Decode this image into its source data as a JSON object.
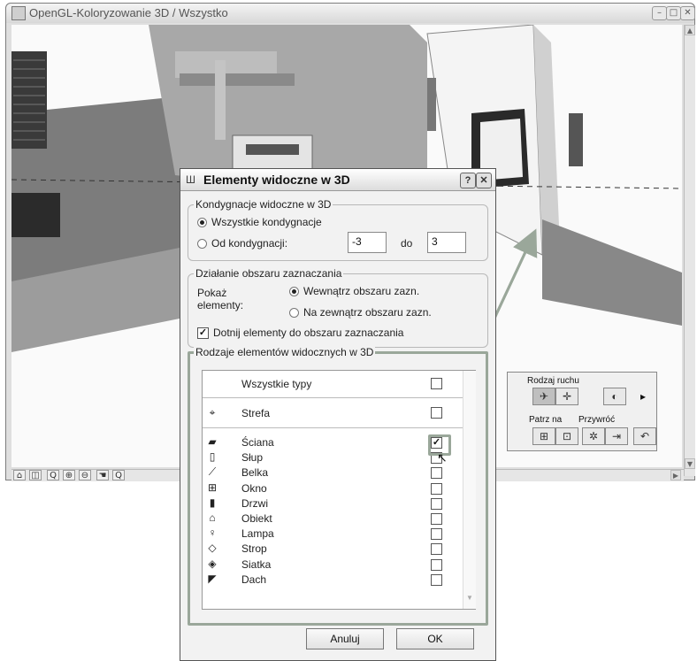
{
  "main_window": {
    "title": "OpenGL-Koloryzowanie 3D / Wszystko",
    "controls": [
      "–",
      "□",
      "✕"
    ],
    "nav_toolbar": [
      "⌂",
      "◫",
      "Q",
      "⊕",
      "⊖",
      "☚",
      "Q"
    ]
  },
  "nav_palette": {
    "movement_label": "Rodzaj ruchu",
    "look_at_label": "Patrz na",
    "restore_label": "Przywróć",
    "expand": "▸"
  },
  "dialog": {
    "title": "Elementy widoczne w 3D",
    "help_label": "?",
    "close_label": "✕",
    "floors_group": {
      "title": "Kondygnacje widoczne w 3D",
      "all_label": "Wszystkie kondygnacje",
      "from_label": "Od kondygnacji:",
      "from_value": "-3",
      "to_label": "do",
      "to_value": "3"
    },
    "marquee_group": {
      "title": "Działanie obszaru zaznaczania",
      "show_label": "Pokaż\nelementy:",
      "inside_label": "Wewnątrz obszaru zazn.",
      "outside_label": "Na zewnątrz obszaru zazn.",
      "trim_label": "Dotnij elementy do obszaru zaznaczania",
      "trim_checked": true
    },
    "types_group": {
      "title": "Rodzaje elementów widocznych w 3D",
      "all_types_label": "Wszystkie typy",
      "zone_label": "Strefa",
      "items": [
        {
          "label": "Ściana",
          "icon": "wall-icon",
          "glyph": "▰",
          "checked": true
        },
        {
          "label": "Słup",
          "icon": "column-icon",
          "glyph": "▯",
          "checked": false
        },
        {
          "label": "Belka",
          "icon": "beam-icon",
          "glyph": "⟋",
          "checked": false
        },
        {
          "label": "Okno",
          "icon": "window-icon",
          "glyph": "⊞",
          "checked": false
        },
        {
          "label": "Drzwi",
          "icon": "door-icon",
          "glyph": "▮",
          "checked": false
        },
        {
          "label": "Obiekt",
          "icon": "object-icon",
          "glyph": "⌂",
          "checked": false
        },
        {
          "label": "Lampa",
          "icon": "lamp-icon",
          "glyph": "♀",
          "checked": false
        },
        {
          "label": "Strop",
          "icon": "slab-icon",
          "glyph": "◇",
          "checked": false
        },
        {
          "label": "Siatka",
          "icon": "mesh-icon",
          "glyph": "◈",
          "checked": false
        },
        {
          "label": "Dach",
          "icon": "roof-icon",
          "glyph": "◤",
          "checked": false
        }
      ]
    },
    "cancel_label": "Anuluj",
    "ok_label": "OK"
  },
  "colors": {
    "highlight": "#9aa79a",
    "window_bg": "#dfdfdf",
    "dialog_bg": "#f2f2f2"
  }
}
